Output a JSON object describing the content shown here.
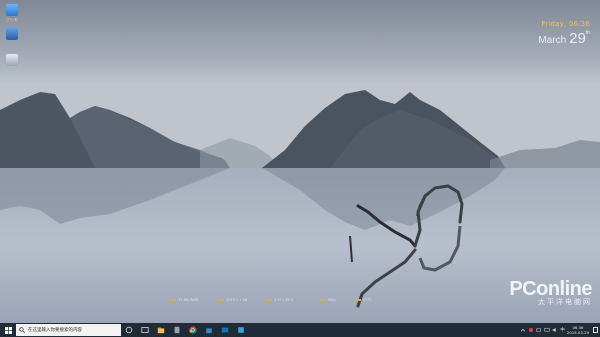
{
  "desktop": {
    "icons": [
      {
        "name": "computer-icon",
        "label": "此电脑"
      },
      {
        "name": "network-icon",
        "label": ""
      },
      {
        "name": "recycle-bin-icon",
        "label": ""
      }
    ]
  },
  "clock_widget": {
    "weekday": "Friday",
    "time": "06:36",
    "month": "March",
    "day": "29",
    "suffix": "th"
  },
  "status_strip": [
    {
      "label": "43.6% RAM"
    },
    {
      "label": "2019.1.1 08"
    },
    {
      "label": "2.97 / 35.6"
    },
    {
      "label": "98%"
    },
    {
      "label": "27°C"
    }
  ],
  "watermark": {
    "brand": "PConline",
    "sub": "太平洋电脑网"
  },
  "taskbar": {
    "search_placeholder": "在这里输入你要搜索的内容",
    "apps": [
      "task-view-icon",
      "file-explorer-icon",
      "store-icon",
      "chrome-icon",
      "mail-icon",
      "terminal-icon",
      "app-icon"
    ],
    "tray": {
      "ime": "中",
      "time": "06:36",
      "date": "2019-03-29"
    }
  },
  "colors": {
    "taskbar": "#1f2b36",
    "clock_accent": "#f0c43c",
    "sky": "#9aa3b0"
  }
}
